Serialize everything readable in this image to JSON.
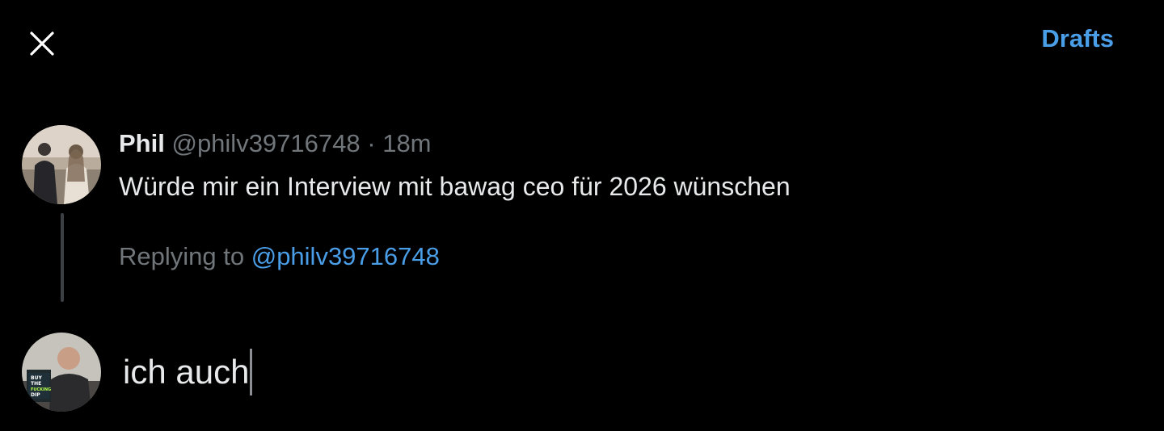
{
  "header": {
    "close_icon": "close-icon",
    "drafts_label": "Drafts"
  },
  "tweet": {
    "author_name": "Phil",
    "author_handle": "@philv39716748",
    "separator": "·",
    "time": "18m",
    "text": "Würde mir ein Interview mit bawag ceo für 2026 wünschen",
    "avatar_icon": "user-avatar"
  },
  "reply": {
    "replying_prefix": "Replying to",
    "replying_handle": "@philv39716748",
    "compose_value": "ich auch",
    "avatar_icon": "own-avatar",
    "avatar_shirt_text": "BUY THE FUCKING DIP"
  },
  "colors": {
    "background": "#000000",
    "accent": "#4a9ee8",
    "primary_text": "#e7e9ea",
    "secondary_text": "#71767b"
  }
}
